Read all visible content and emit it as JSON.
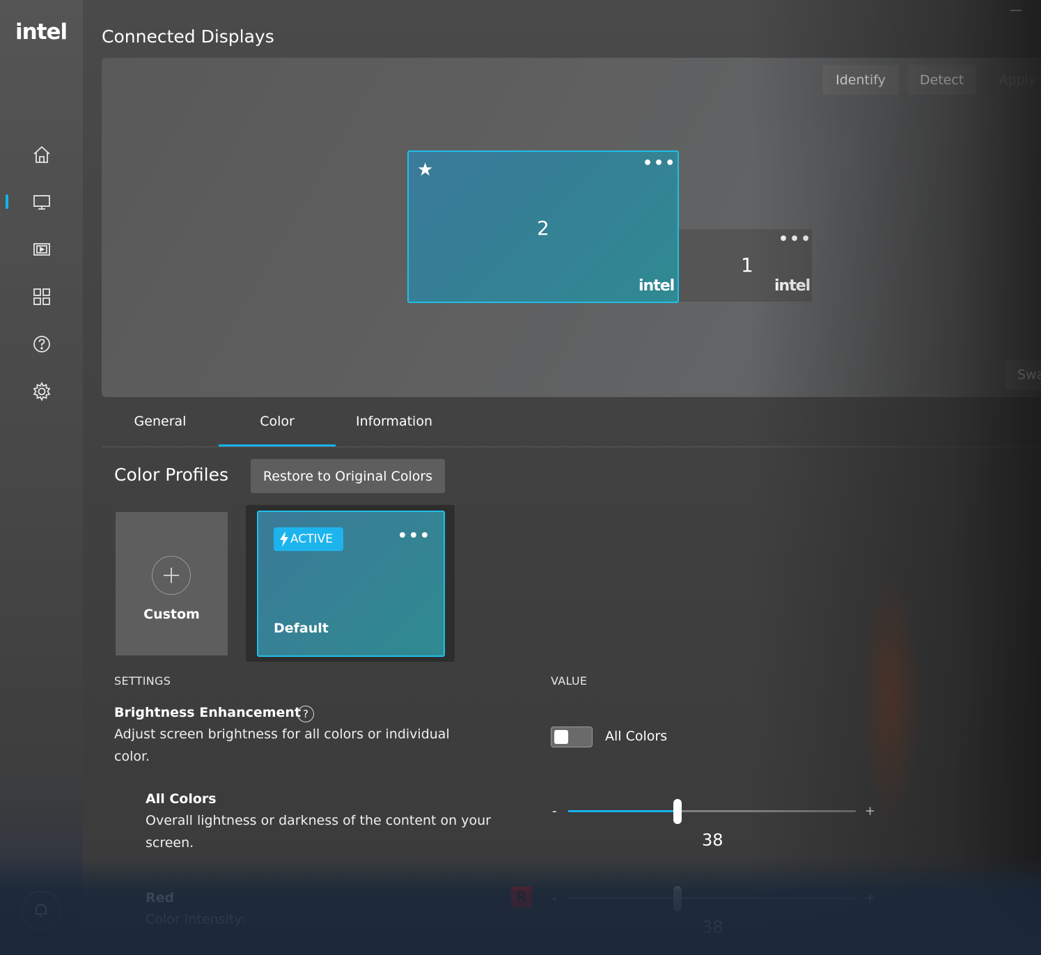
{
  "app": {
    "logo": "intel",
    "page_title": "Connected Displays"
  },
  "sidebar": {
    "items": [
      {
        "icon": "home-icon"
      },
      {
        "icon": "display-icon",
        "active": true
      },
      {
        "icon": "video-icon"
      },
      {
        "icon": "apps-grid-icon"
      },
      {
        "icon": "help-icon"
      },
      {
        "icon": "settings-gear-icon"
      }
    ],
    "bell_icon": "notification-bell-icon"
  },
  "toolbar": {
    "identify": "Identify",
    "detect": "Detect",
    "apply": "Apply",
    "swap": "Swa"
  },
  "monitors": [
    {
      "number": "2",
      "primary": true,
      "logo": "intel",
      "menu": "•••"
    },
    {
      "number": "1",
      "primary": false,
      "logo": "intel",
      "menu": "•••"
    }
  ],
  "tabs": [
    {
      "label": "General"
    },
    {
      "label": "Color",
      "selected": true
    },
    {
      "label": "Information"
    }
  ],
  "color_profiles": {
    "title": "Color Profiles",
    "restore_button": "Restore to Original Colors",
    "custom_label": "Custom",
    "default_card": {
      "badge": "ACTIVE",
      "label": "Default",
      "menu": "•••"
    }
  },
  "columns": {
    "settings": "SETTINGS",
    "value": "VALUE"
  },
  "brightness": {
    "title": "Brightness Enhancement",
    "desc_line1": "Adjust screen brightness for all colors or individual",
    "desc_line2": "color.",
    "toggle_label": "All Colors",
    "toggle_on": false
  },
  "all_colors": {
    "title": "All Colors",
    "desc_line1": "Overall lightness or darkness of the content on your",
    "desc_line2": "screen.",
    "minus": "-",
    "plus": "+",
    "value": "38",
    "fill_fraction": 0.38
  },
  "red": {
    "title": "Red",
    "desc": "Color Intensity:",
    "badge": "R",
    "minus": "-",
    "plus": "+",
    "value": "38",
    "fill_fraction": 0.38
  },
  "colors": {
    "accent": "#16b2ec",
    "red_badge": "#ee1111"
  }
}
